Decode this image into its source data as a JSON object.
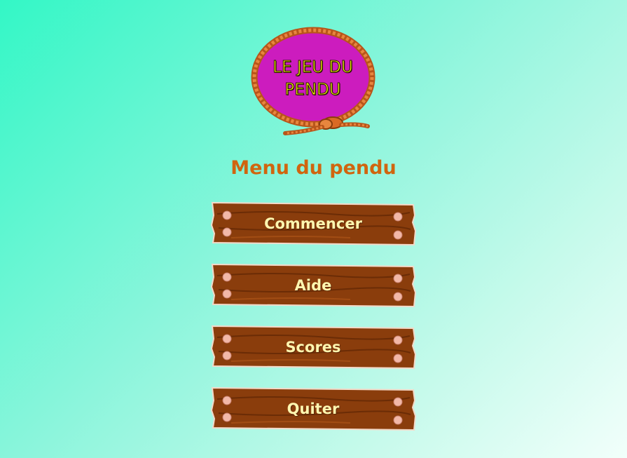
{
  "logo": {
    "line1": "LE JEU DU",
    "line2": "PENDU"
  },
  "menu": {
    "title": "Menu du pendu",
    "buttons": [
      {
        "label": "Commencer"
      },
      {
        "label": "Aide"
      },
      {
        "label": "Scores"
      },
      {
        "label": "Quiter"
      }
    ]
  },
  "colors": {
    "background_start": "#33f7c6",
    "background_end": "#f2fffb",
    "title": "#d0650f",
    "logo_fill": "#cc1cbe",
    "rope": "#d96a24",
    "wood": "#8a3d0c",
    "button_text": "#fff6b0"
  }
}
